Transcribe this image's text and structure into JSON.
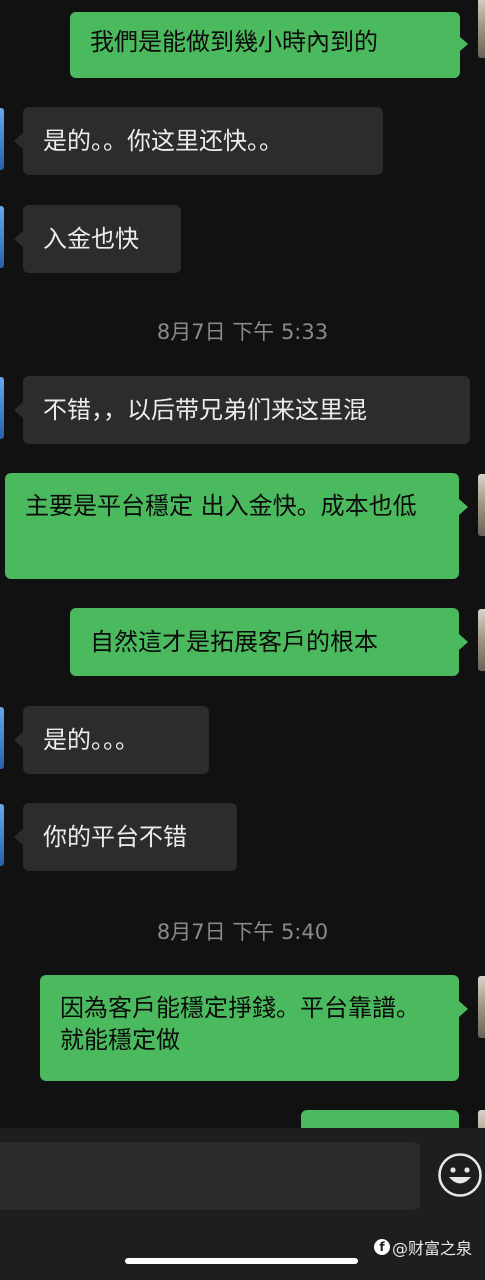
{
  "messages": [
    {
      "side": "out",
      "text": "我們是能做到幾小時內到的"
    },
    {
      "side": "in",
      "text": "是的。。你这里还快。。"
    },
    {
      "side": "in",
      "text": "入金也快"
    },
    {
      "side": "in",
      "text": "不错，，以后带兄弟们来这里混"
    },
    {
      "side": "out",
      "text": "主要是平台穩定 出入金快。成本也低"
    },
    {
      "side": "out",
      "text": "自然這才是拓展客戶的根本"
    },
    {
      "side": "in",
      "text": "是的。。。"
    },
    {
      "side": "in",
      "text": "你的平台不错"
    },
    {
      "side": "out",
      "text": "因為客戶能穩定掙錢。平台靠譜。就能穩定做"
    }
  ],
  "timestamps": [
    "8月7日 下午 5:33",
    "8月7日 下午 5:40"
  ],
  "input": {
    "placeholder": ""
  },
  "icons": {
    "emoji": "emoji-smiley-icon"
  },
  "watermark": {
    "text": "@财富之泉",
    "logo": "f"
  },
  "colors": {
    "background": "#111111",
    "incoming_bubble": "#2c2c2c",
    "outgoing_bubble": "#4bb95d",
    "timestamp": "#8a8a8a"
  }
}
